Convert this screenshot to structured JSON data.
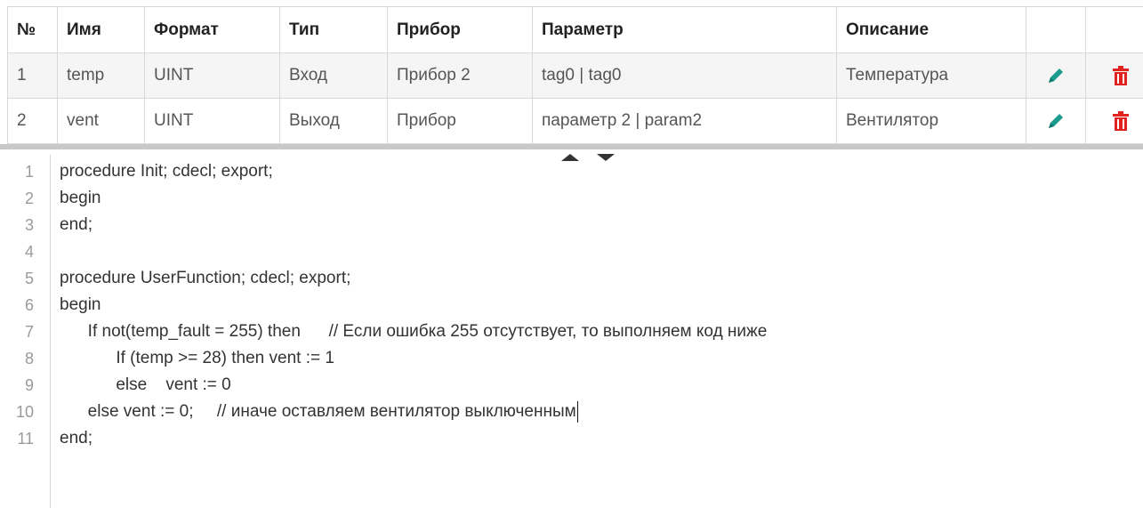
{
  "table": {
    "headers": [
      "№",
      "Имя",
      "Формат",
      "Тип",
      "Прибор",
      "Параметр",
      "Описание",
      "",
      ""
    ],
    "rows": [
      {
        "num": "1",
        "name": "temp",
        "format": "UINT",
        "type": "Вход",
        "device": "Прибор 2",
        "param": "tag0 | tag0",
        "desc": "Температура"
      },
      {
        "num": "2",
        "name": "vent",
        "format": "UINT",
        "type": "Выход",
        "device": "Прибор",
        "param": "параметр 2 | param2",
        "desc": "Вентилятор"
      }
    ],
    "icons": {
      "edit": "pencil-icon",
      "delete": "trash-icon"
    },
    "colors": {
      "edit": "#1a9b8d",
      "delete": "#e0231e"
    }
  },
  "editor": {
    "lines": [
      {
        "n": "1",
        "text": "procedure Init; cdecl; export;"
      },
      {
        "n": "2",
        "text": "begin"
      },
      {
        "n": "3",
        "text": "end;"
      },
      {
        "n": "4",
        "text": ""
      },
      {
        "n": "5",
        "text": "procedure UserFunction; cdecl; export;"
      },
      {
        "n": "6",
        "text": "begin"
      },
      {
        "n": "7",
        "text": "      If not(temp_fault = 255) then      // Если ошибка 255 отсутствует, то выполняем код ниже"
      },
      {
        "n": "8",
        "text": "            If (temp >= 28) then vent := 1"
      },
      {
        "n": "9",
        "text": "            else    vent := 0"
      },
      {
        "n": "10",
        "text": "      else vent := 0;     // иначе оставляем вентилятор выключенным"
      },
      {
        "n": "11",
        "text": "end;"
      }
    ]
  }
}
